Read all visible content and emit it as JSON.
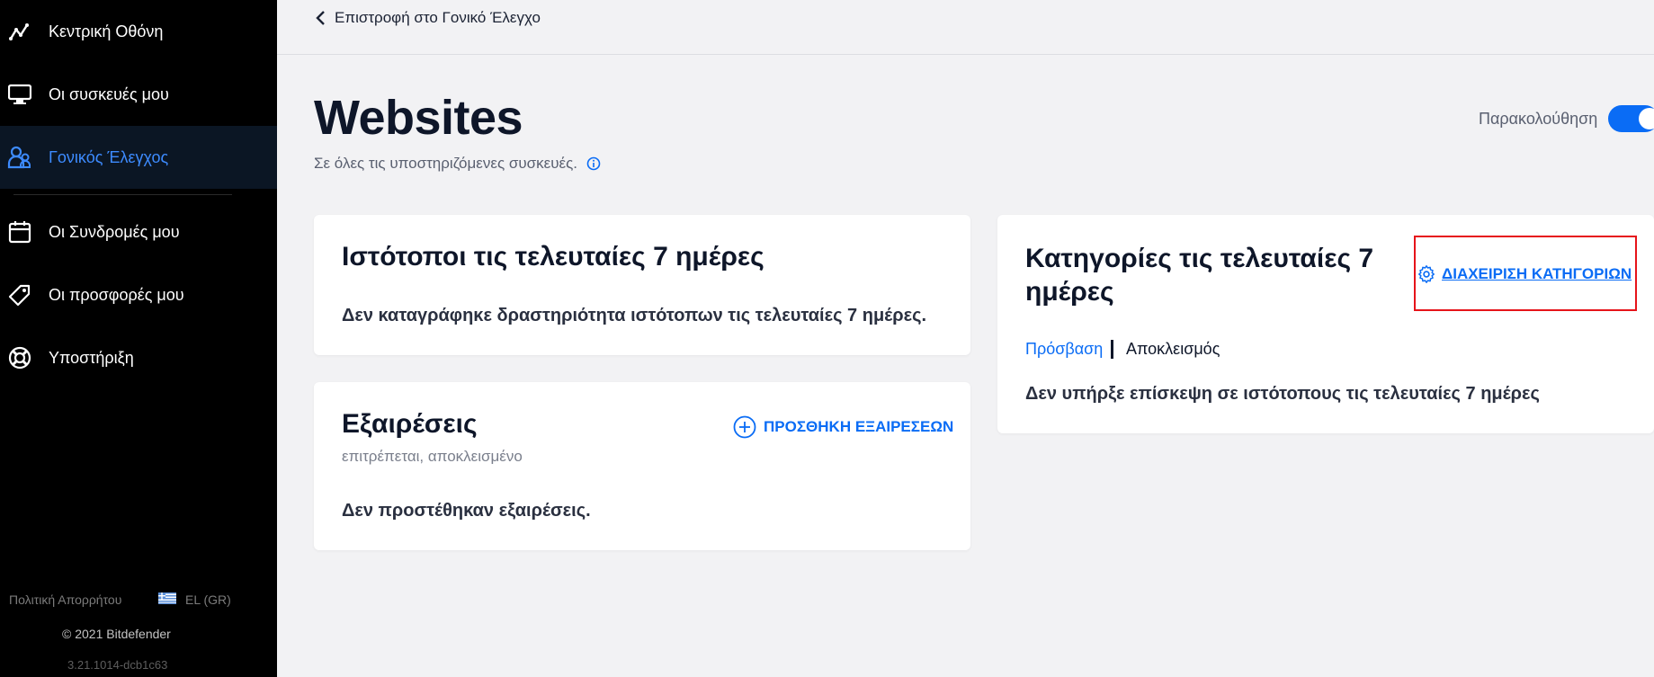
{
  "sidebar": {
    "items": [
      {
        "label": "Κεντρική Οθόνη",
        "icon": "activity-icon"
      },
      {
        "label": "Οι συσκευές μου",
        "icon": "monitor-icon"
      },
      {
        "label": "Γονικός Έλεγχος",
        "icon": "parental-icon",
        "active": true
      },
      {
        "label": "Οι Συνδρομές μου",
        "icon": "calendar-icon"
      },
      {
        "label": "Οι προσφορές μου",
        "icon": "tag-icon"
      },
      {
        "label": "Υποστήριξη",
        "icon": "lifebuoy-icon"
      }
    ],
    "footer": {
      "privacy": "Πολιτική Απορρήτου",
      "language": "EL (GR)",
      "copyright": "© 2021 Bitdefender",
      "version": "3.21.1014-dcb1c63"
    }
  },
  "topbar": {
    "back_label": "Επιστροφή στο Γονικό Έλεγχο"
  },
  "header": {
    "title": "Websites",
    "subtitle": "Σε όλες τις υποστηριζόμενες συσκευές.",
    "monitoring_label": "Παρακολούθηση",
    "monitoring_on": true
  },
  "websites_card": {
    "title": "Ιστότοποι τις τελευταίες 7 ημέρες",
    "empty_text": "Δεν καταγράφηκε δραστηριότητα ιστότοπων τις τελευταίες 7 ημέρες."
  },
  "exceptions_card": {
    "title": "Εξαιρέσεις",
    "subtitle": "επιτρέπεται, αποκλεισμένο",
    "add_label": "ΠΡΟΣΘΗΚΗ ΕΞΑΙΡΕΣΕΩΝ",
    "empty_text": "Δεν προστέθηκαν εξαιρέσεις."
  },
  "categories_card": {
    "title_line1": "Κατηγορίες τις τελευταίες 7",
    "title_line2": "ημέρες",
    "manage_label": "ΔΙΑΧΕΙΡΙΣΗ ΚΑΤΗΓΟΡΙΩΝ",
    "tabs": [
      "Πρόσβαση",
      "Αποκλεισμός"
    ],
    "empty_text": "Δεν υπήρξε επίσκεψη σε ιστότοπους τις τελευταίες 7 ημέρες"
  },
  "colors": {
    "accent": "#0a6cf5",
    "sidebar_bg": "#000000",
    "highlight": "#e6141a"
  }
}
